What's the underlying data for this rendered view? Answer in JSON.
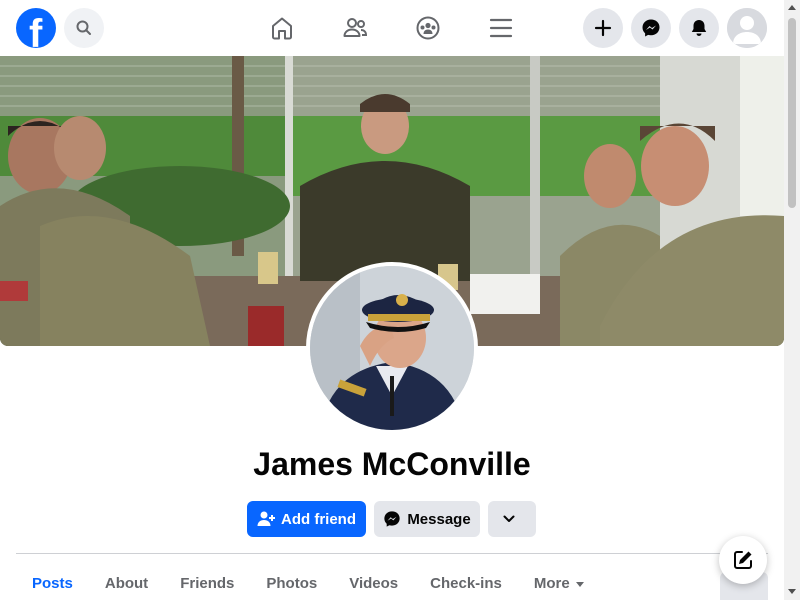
{
  "topbar": {
    "logo_letter": "f",
    "icons": [
      "facebook-logo",
      "search-icon",
      "home-icon",
      "friends-icon",
      "groups-icon",
      "menu-icon",
      "plus-icon",
      "messenger-icon",
      "bell-icon",
      "avatar"
    ]
  },
  "profile": {
    "name": "James McConville"
  },
  "actions": {
    "add_friend": "Add friend",
    "message": "Message"
  },
  "tabs": [
    {
      "label": "Posts",
      "active": true
    },
    {
      "label": "About"
    },
    {
      "label": "Friends"
    },
    {
      "label": "Photos"
    },
    {
      "label": "Videos"
    },
    {
      "label": "Check-ins"
    },
    {
      "label": "More"
    }
  ],
  "colors": {
    "brand": "#0866ff",
    "button_gray": "#e4e6eb",
    "text_secondary": "#65676b"
  }
}
